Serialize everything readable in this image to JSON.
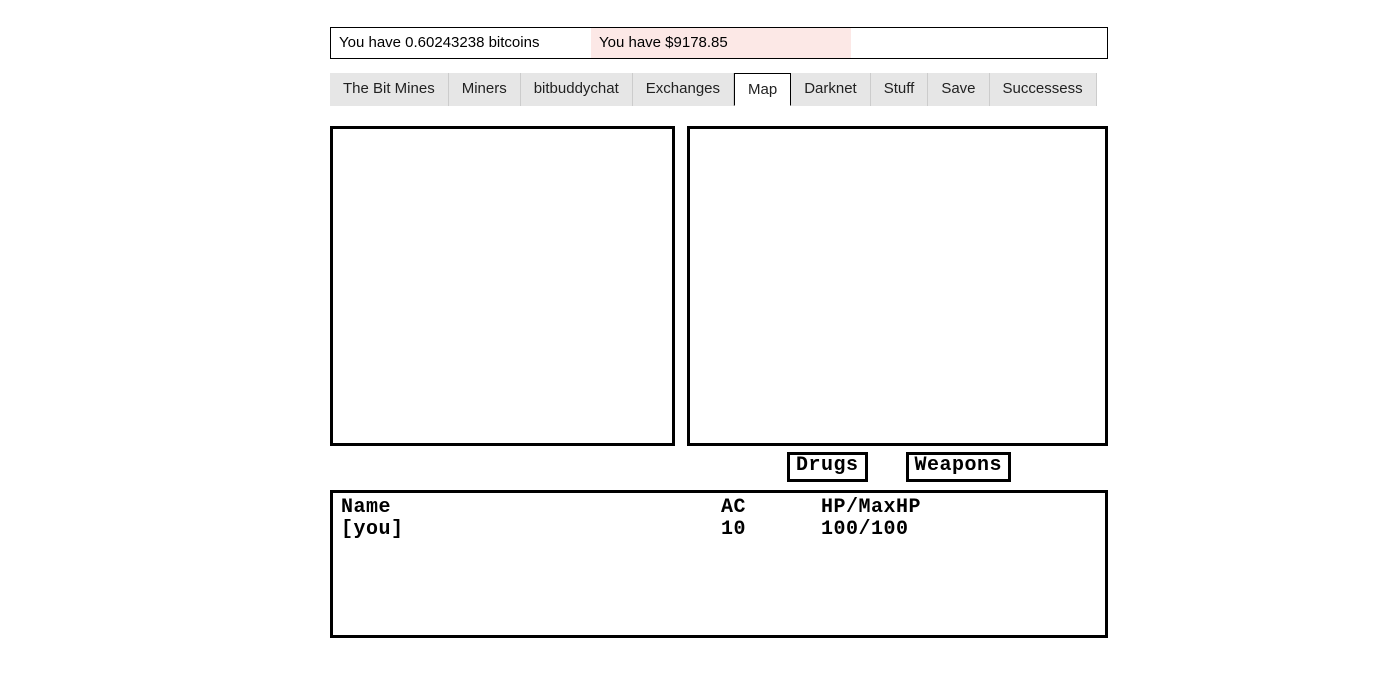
{
  "status": {
    "bitcoins": "You have 0.60243238 bitcoins",
    "money": "You have $9178.85"
  },
  "tabs": [
    {
      "label": "The Bit Mines"
    },
    {
      "label": "Miners"
    },
    {
      "label": "bitbuddychat"
    },
    {
      "label": "Exchanges"
    },
    {
      "label": "Map"
    },
    {
      "label": "Darknet"
    },
    {
      "label": "Stuff"
    },
    {
      "label": "Save"
    },
    {
      "label": "Successess"
    }
  ],
  "buttons": {
    "drugs": "Drugs",
    "weapons": "Weapons"
  },
  "stats": {
    "headers": {
      "name": "Name",
      "ac": "AC",
      "hp": "HP/MaxHP"
    },
    "row": {
      "name": "[you]",
      "ac": "10",
      "hp": "100/100"
    }
  }
}
